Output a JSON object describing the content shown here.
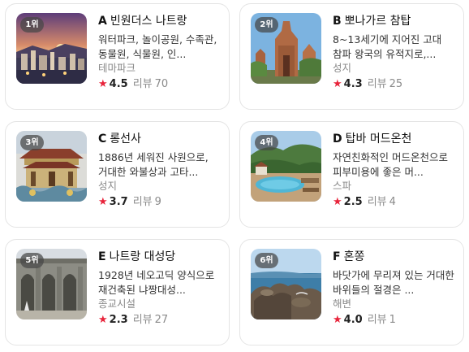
{
  "cards": [
    {
      "rank": "1위",
      "letter": "A",
      "name": "빈원더스 나트랑",
      "desc": "워터파크, 놀이공원, 수족관, 동물원, 식물원, 인...",
      "category": "테마파크",
      "rating": "4.5",
      "review_label": "리뷰",
      "reviews": "70"
    },
    {
      "rank": "2위",
      "letter": "B",
      "name": "뽀나가르 참탑",
      "desc": "8~13세기에 지어진 고대 참파 왕국의 유적지로,...",
      "category": "성지",
      "rating": "4.3",
      "review_label": "리뷰",
      "reviews": "25"
    },
    {
      "rank": "3위",
      "letter": "C",
      "name": "롱선사",
      "desc": "1886년 세워진 사원으로, 거대한 와불상과 고타...",
      "category": "성지",
      "rating": "3.7",
      "review_label": "리뷰",
      "reviews": "9"
    },
    {
      "rank": "4위",
      "letter": "D",
      "name": "탑바 머드온천",
      "desc": "자연친화적인 머드온천으로 피부미용에 좋은 머...",
      "category": "스파",
      "rating": "2.5",
      "review_label": "리뷰",
      "reviews": "4"
    },
    {
      "rank": "5위",
      "letter": "E",
      "name": "나트랑 대성당",
      "desc": "1928년 네오고딕 양식으로 재건축된 냐짱대성...",
      "category": "종교시설",
      "rating": "2.3",
      "review_label": "리뷰",
      "reviews": "27"
    },
    {
      "rank": "6위",
      "letter": "F",
      "name": "혼쫑",
      "desc": "바닷가에 무리져 있는 거대한 바위들의 절경은 ...",
      "category": "해변",
      "rating": "4.0",
      "review_label": "리뷰",
      "reviews": "1"
    }
  ],
  "colors": {
    "star": "#e8243b",
    "border": "#e4e4e4",
    "category": "#8a8a8a"
  },
  "icons": {
    "star": "star-icon"
  }
}
